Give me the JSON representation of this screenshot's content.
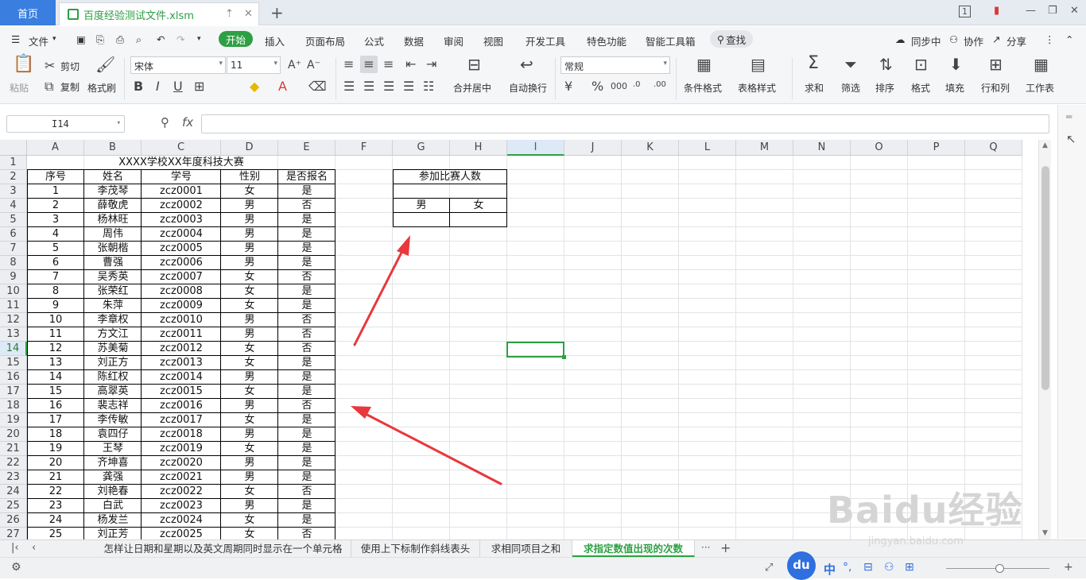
{
  "titlebar": {
    "home_tab": "首页",
    "file_tab": "百度经验测试文件.xlsm",
    "new_tab": "+",
    "badge": "1"
  },
  "menubar": {
    "file": "文件",
    "items": [
      "开始",
      "插入",
      "页面布局",
      "公式",
      "数据",
      "审阅",
      "视图",
      "开发工具",
      "特色功能",
      "智能工具箱"
    ],
    "search": "查找",
    "sync": "同步中",
    "collab": "协作",
    "share": "分享"
  },
  "ribbon": {
    "paste": "粘贴",
    "cut": "剪切",
    "copy": "复制",
    "format_painter": "格式刷",
    "font_name": "宋体",
    "font_size": "11",
    "merge_center": "合并居中",
    "wrap_text": "自动换行",
    "number_format": "常规",
    "conditional_format": "条件格式",
    "table_style": "表格样式",
    "sum": "求和",
    "filter": "筛选",
    "sort": "排序",
    "format": "格式",
    "fill": "填充",
    "row_col": "行和列",
    "worksheet": "工作表"
  },
  "formulabar": {
    "name_box": "I14",
    "fx": "fx"
  },
  "columns": [
    "A",
    "B",
    "C",
    "D",
    "E",
    "F",
    "G",
    "H",
    "I",
    "J",
    "K",
    "L",
    "M",
    "N",
    "O",
    "P",
    "Q"
  ],
  "rows": [
    "1",
    "2",
    "3",
    "4",
    "5",
    "6",
    "7",
    "8",
    "9",
    "10",
    "11",
    "12",
    "13",
    "14",
    "15",
    "16",
    "17",
    "18",
    "19",
    "20",
    "21",
    "22",
    "23",
    "24",
    "25",
    "26",
    "27"
  ],
  "sheet": {
    "title": "XXXX学校XX年度科技大赛",
    "headers": [
      "序号",
      "姓名",
      "学号",
      "性别",
      "是否报名"
    ],
    "records": [
      [
        "1",
        "李茂琴",
        "zcz0001",
        "女",
        "是"
      ],
      [
        "2",
        "薛敬虎",
        "zcz0002",
        "男",
        "否"
      ],
      [
        "3",
        "杨林旺",
        "zcz0003",
        "男",
        "是"
      ],
      [
        "4",
        "周伟",
        "zcz0004",
        "男",
        "是"
      ],
      [
        "5",
        "张朝楷",
        "zcz0005",
        "男",
        "是"
      ],
      [
        "6",
        "曹强",
        "zcz0006",
        "男",
        "是"
      ],
      [
        "7",
        "吴秀英",
        "zcz0007",
        "女",
        "否"
      ],
      [
        "8",
        "张荣红",
        "zcz0008",
        "女",
        "是"
      ],
      [
        "9",
        "朱萍",
        "zcz0009",
        "女",
        "是"
      ],
      [
        "10",
        "李章权",
        "zcz0010",
        "男",
        "否"
      ],
      [
        "11",
        "方文江",
        "zcz0011",
        "男",
        "否"
      ],
      [
        "12",
        "苏美菊",
        "zcz0012",
        "女",
        "否"
      ],
      [
        "13",
        "刘正方",
        "zcz0013",
        "女",
        "是"
      ],
      [
        "14",
        "陈红权",
        "zcz0014",
        "男",
        "是"
      ],
      [
        "15",
        "高翠英",
        "zcz0015",
        "女",
        "是"
      ],
      [
        "16",
        "裴志祥",
        "zcz0016",
        "男",
        "否"
      ],
      [
        "17",
        "李传敏",
        "zcz0017",
        "女",
        "是"
      ],
      [
        "18",
        "袁四仔",
        "zcz0018",
        "男",
        "是"
      ],
      [
        "19",
        "王琴",
        "zcz0019",
        "女",
        "是"
      ],
      [
        "20",
        "齐坤喜",
        "zcz0020",
        "男",
        "是"
      ],
      [
        "21",
        "龚强",
        "zcz0021",
        "男",
        "是"
      ],
      [
        "22",
        "刘艳春",
        "zcz0022",
        "女",
        "否"
      ],
      [
        "23",
        "白武",
        "zcz0023",
        "男",
        "是"
      ],
      [
        "24",
        "杨发兰",
        "zcz0024",
        "女",
        "是"
      ],
      [
        "25",
        "刘正芳",
        "zcz0025",
        "女",
        "否"
      ]
    ],
    "summary_title": "参加比赛人数",
    "summary_male": "男",
    "summary_female": "女"
  },
  "sheet_tabs": [
    "怎样让日期和星期以及英文周期同时显示在一个单元格",
    "使用上下标制作斜线表头",
    "求相同项目之和",
    "求指定数值出现的次数"
  ],
  "sheet_more": "···",
  "status": {
    "ime_cn": "中",
    "ime_du": "du"
  },
  "watermark": {
    "brand": "Baidu经验",
    "url": "jingyan.baidu.com"
  },
  "colors": {
    "accent_green": "#2ea043",
    "home_blue": "#3a7ee0",
    "arrow_red": "#e8383b"
  }
}
